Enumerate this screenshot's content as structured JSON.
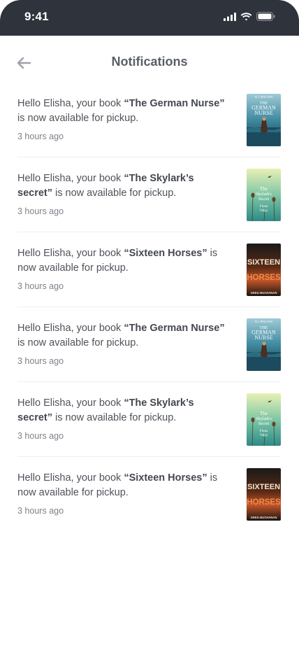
{
  "status_bar": {
    "time": "9:41"
  },
  "header": {
    "title": "Notifications",
    "back_icon": "arrow-left-icon"
  },
  "notifications": [
    {
      "prefix": "Hello Elisha, your book ",
      "book": "“The German Nurse”",
      "suffix": " is now available for pickup.",
      "time": "3 hours ago",
      "cover": "german-nurse",
      "cover_text": {
        "author": "M. J. HOLLOWS",
        "line1": "THE",
        "line2": "GERMAN",
        "line3": "NURSE"
      }
    },
    {
      "prefix": "Hello Elisha, your book ",
      "book": "“The Skylark’s secret”",
      "suffix": " is now available for pickup.",
      "time": "3 hours ago",
      "cover": "skylark",
      "cover_text": {
        "line1": "The",
        "line2": "Skylark's",
        "line3": "Secret",
        "author1": "Fiona",
        "author2": "Valpy"
      }
    },
    {
      "prefix": "Hello Elisha, your book ",
      "book": "“Sixteen Horses”",
      "suffix": " is now available for pickup.",
      "time": "3 hours ago",
      "cover": "sixteen",
      "cover_text": {
        "line1": "SIXTEEN",
        "line2": "HORSES",
        "author": "GREG BUCHANAN"
      }
    },
    {
      "prefix": "Hello Elisha, your book ",
      "book": "“The German Nurse”",
      "suffix": " is now available for pickup.",
      "time": "3 hours ago",
      "cover": "german-nurse",
      "cover_text": {
        "author": "M. J. HOLLOWS",
        "line1": "THE",
        "line2": "GERMAN",
        "line3": "NURSE"
      }
    },
    {
      "prefix": "Hello Elisha, your book ",
      "book": "“The Skylark’s secret”",
      "suffix": " is now available for pickup.",
      "time": "3 hours ago",
      "cover": "skylark",
      "cover_text": {
        "line1": "The",
        "line2": "Skylark's",
        "line3": "Secret",
        "author1": "Fiona",
        "author2": "Valpy"
      }
    },
    {
      "prefix": "Hello Elisha, your book ",
      "book": "“Sixteen Horses”",
      "suffix": " is now available for pickup.",
      "time": "3 hours ago",
      "cover": "sixteen",
      "cover_text": {
        "line1": "SIXTEEN",
        "line2": "HORSES",
        "author": "GREG BUCHANAN"
      }
    }
  ]
}
